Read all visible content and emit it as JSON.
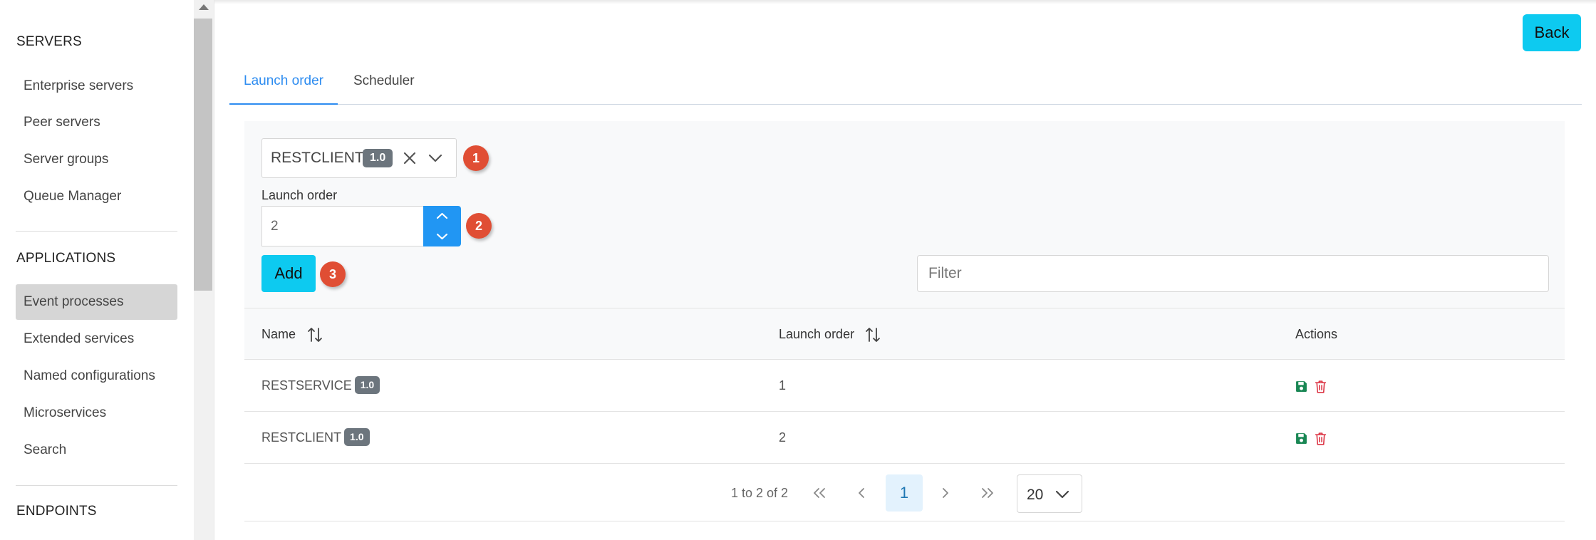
{
  "sidebar": {
    "sections": [
      {
        "title": "SERVERS",
        "items": [
          "Enterprise servers",
          "Peer servers",
          "Server groups",
          "Queue Manager"
        ]
      },
      {
        "title": "APPLICATIONS",
        "items": [
          "Event processes",
          "Extended services",
          "Named configurations",
          "Microservices",
          "Search"
        ]
      },
      {
        "title": "ENDPOINTS",
        "items": []
      }
    ],
    "active_item": "Event processes"
  },
  "header": {
    "back_label": "Back"
  },
  "tabs": [
    {
      "label": "Launch order",
      "active": true
    },
    {
      "label": "Scheduler",
      "active": false
    }
  ],
  "form": {
    "select_value": "RESTCLIENT",
    "select_version": "1.0",
    "launch_order_label": "Launch order",
    "launch_order_value": "2",
    "add_label": "Add",
    "filter_placeholder": "Filter",
    "steps": [
      "1",
      "2",
      "3"
    ]
  },
  "table": {
    "columns": [
      "Name",
      "Launch order",
      "Actions"
    ],
    "rows": [
      {
        "name": "RESTSERVICE",
        "version": "1.0",
        "launch_order": "1"
      },
      {
        "name": "RESTCLIENT",
        "version": "1.0",
        "launch_order": "2"
      }
    ]
  },
  "pagination": {
    "summary": "1 to 2 of 2",
    "current_page": "1",
    "page_size": "20"
  },
  "colors": {
    "accent": "#0dcaf0",
    "tab_active": "#2d8cf0",
    "spinner": "#2196f3",
    "step_badge": "#e04e34",
    "save_icon": "#198754",
    "trash_icon": "#dc3545"
  }
}
